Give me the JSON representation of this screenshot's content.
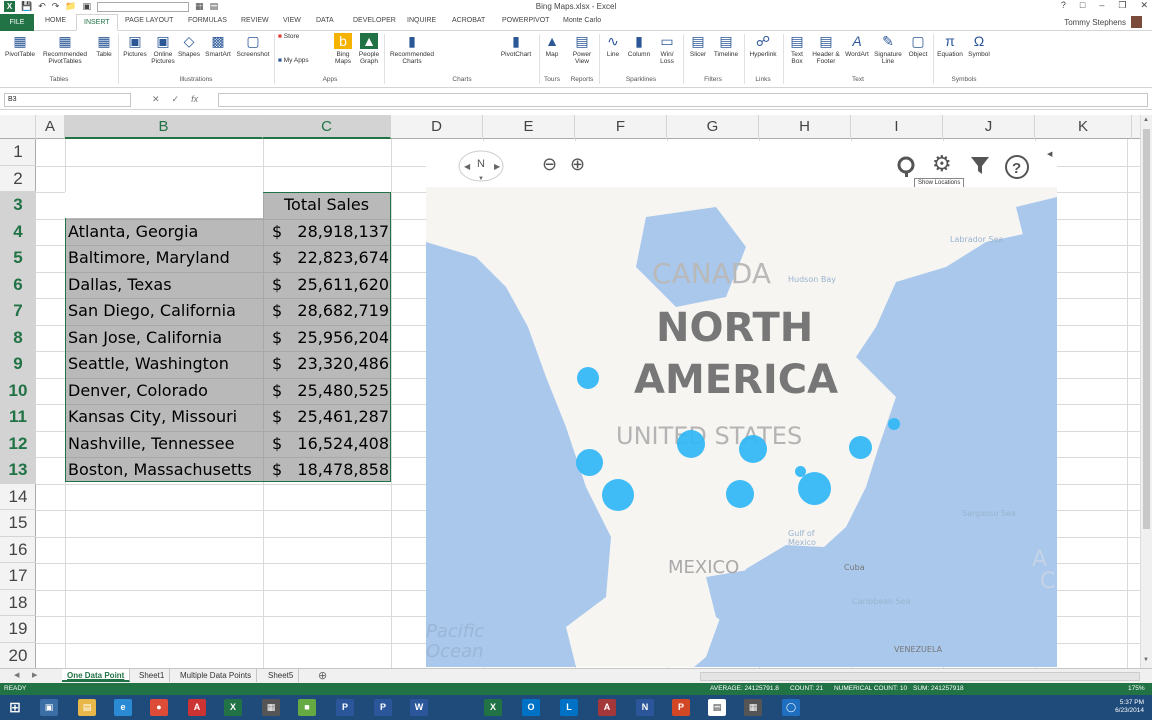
{
  "titlebar": {
    "title": "Bing Maps.xlsx - Excel",
    "user": "Tommy Stephens",
    "help": "?"
  },
  "tabs": [
    "FILE",
    "HOME",
    "INSERT",
    "PAGE LAYOUT",
    "FORMULAS",
    "REVIEW",
    "VIEW",
    "DATA",
    "DEVELOPER",
    "INQUIRE",
    "ACROBAT",
    "POWERPIVOT",
    "Monte Carlo"
  ],
  "ribbon": {
    "buttons": [
      {
        "label": "PivotTable"
      },
      {
        "label": "Recommended PivotTables"
      },
      {
        "label": "Table"
      },
      {
        "label": "Pictures"
      },
      {
        "label": "Online Pictures"
      },
      {
        "label": "Shapes"
      },
      {
        "label": "SmartArt"
      },
      {
        "label": "Screenshot"
      },
      {
        "label": "Store"
      },
      {
        "label": "My Apps"
      },
      {
        "label": "Bing Maps"
      },
      {
        "label": "People Graph"
      },
      {
        "label": "Recommended Charts"
      },
      {
        "label": "PivotChart"
      },
      {
        "label": "Map"
      },
      {
        "label": "Power View"
      },
      {
        "label": "Line"
      },
      {
        "label": "Column"
      },
      {
        "label": "Win/ Loss"
      },
      {
        "label": "Slicer"
      },
      {
        "label": "Timeline"
      },
      {
        "label": "Hyperlink"
      },
      {
        "label": "Text Box"
      },
      {
        "label": "Header & Footer"
      },
      {
        "label": "WordArt"
      },
      {
        "label": "Signature Line"
      },
      {
        "label": "Object"
      },
      {
        "label": "Equation"
      },
      {
        "label": "Symbol"
      }
    ],
    "groups": [
      "Tables",
      "Illustrations",
      "Apps",
      "Charts",
      "Tours",
      "Reports",
      "Sparklines",
      "Filters",
      "Links",
      "Text",
      "Symbols"
    ]
  },
  "formula_bar": {
    "name_box": "B3",
    "formula": ""
  },
  "columns": [
    "A",
    "B",
    "C",
    "D",
    "E",
    "F",
    "G",
    "H",
    "I",
    "J",
    "K"
  ],
  "rows": [
    "1",
    "2",
    "3",
    "4",
    "5",
    "6",
    "7",
    "8",
    "9",
    "10",
    "11",
    "12",
    "13",
    "14",
    "15",
    "16",
    "17",
    "18",
    "19",
    "20"
  ],
  "table": {
    "header": "Total Sales",
    "rows": [
      {
        "city": "Atlanta, Georgia",
        "sales": "28,918,137"
      },
      {
        "city": "Baltimore, Maryland",
        "sales": "22,823,674"
      },
      {
        "city": "Dallas, Texas",
        "sales": "25,611,620"
      },
      {
        "city": "San Diego, California",
        "sales": "28,682,719"
      },
      {
        "city": "San Jose, California",
        "sales": "25,956,204"
      },
      {
        "city": "Seattle, Washington",
        "sales": "23,320,486"
      },
      {
        "city": "Denver, Colorado",
        "sales": "25,480,525"
      },
      {
        "city": "Kansas City, Missouri",
        "sales": "25,461,287"
      },
      {
        "city": "Nashville, Tennessee",
        "sales": "16,524,408"
      },
      {
        "city": "Boston, Massachusetts",
        "sales": "18,478,858"
      }
    ],
    "currency": "$"
  },
  "map": {
    "tooltip": "Show Locations",
    "compass": "N",
    "labels": {
      "continent_1": "NORTH",
      "continent_2": "AMERICA",
      "country_canada": "CANADA",
      "country_us": "UNITED STATES",
      "country_mexico": "MEXICO",
      "ocean": "Pacific Ocean",
      "hudson": "Hudson Bay",
      "labrador": "Labrador Sea",
      "sargasso": "Sargasso Sea",
      "gulf": "Gulf of Mexico",
      "cuba": "Cuba",
      "caribbean": "Caribbean Sea",
      "venezuela": "VENEZUELA",
      "atlantic_1": "A",
      "atlantic_2": "C"
    },
    "colors": {
      "water": "#a9c8ec",
      "bubble": "#35b8f5"
    }
  },
  "sheets": [
    "One Data Point",
    "Sheet1",
    "Multiple Data Points",
    "Sheet5"
  ],
  "status": {
    "mode": "READY",
    "average": "AVERAGE: 24125791.8",
    "count": "COUNT: 21",
    "numerical_count": "NUMERICAL COUNT: 10",
    "sum": "SUM: 241257918",
    "zoom": "175%"
  },
  "clock": {
    "time": "5:37 PM",
    "date": "6/23/2014"
  }
}
